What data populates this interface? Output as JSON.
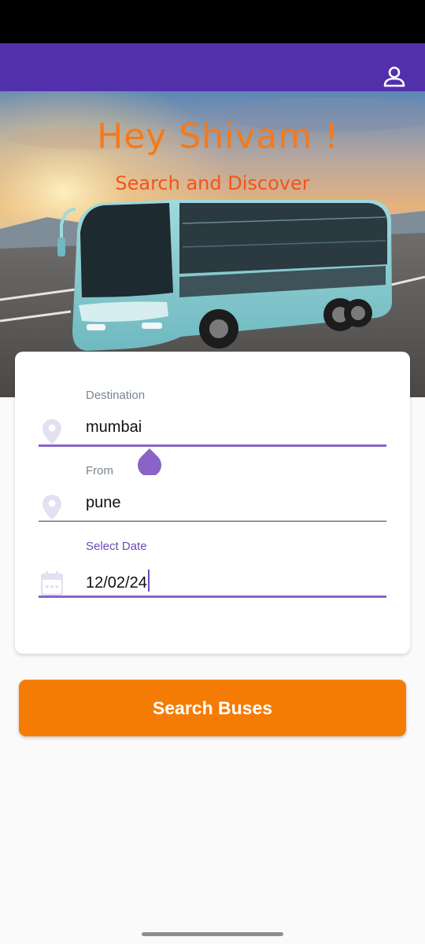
{
  "header": {
    "profile_icon": "person-outline-icon",
    "background_color": "#5230ac"
  },
  "hero": {
    "greeting": "Hey Shivam !",
    "subtitle": "Search and Discover",
    "title_color": "#f47a1a",
    "subtitle_color": "#f0551b"
  },
  "form": {
    "destination": {
      "label": "Destination",
      "value": "mumbai",
      "icon": "location-pin-icon"
    },
    "from": {
      "label": "From",
      "value": "pune",
      "icon": "location-pin-icon"
    },
    "date": {
      "label": "Select Date",
      "value": "12/02/24",
      "icon": "calendar-icon"
    }
  },
  "search_button": {
    "label": "Search Buses",
    "color": "#f57c04"
  },
  "accent_color": "#6b4bb8"
}
